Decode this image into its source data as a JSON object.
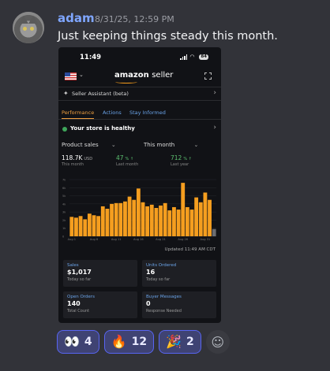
{
  "message": {
    "username": "adam",
    "timestamp": "8/31/25, 12:59 PM",
    "text": "Just keeping things steady this month."
  },
  "screenshot": {
    "status_time": "11:49",
    "battery": "84",
    "app_logo": "amazon",
    "app_logo_suffix": "seller",
    "assistant_label": "Seller Assistant (beta)",
    "tabs": [
      "Performance",
      "Actions",
      "Stay Informed"
    ],
    "health_text": "Your store is healthy",
    "metric_select": "Product sales",
    "period_select": "This month",
    "stats": [
      {
        "value": "118.7K",
        "unit": "USD",
        "sub": "This month"
      },
      {
        "value": "47",
        "pct": "% ↑",
        "sub": "Last month"
      },
      {
        "value": "712",
        "pct": "% ↑",
        "sub": "Last year"
      }
    ],
    "updated": "Updated 11:49 AM CDT",
    "cards": [
      {
        "title": "Sales",
        "value": "$1,017",
        "sub": "Today so far"
      },
      {
        "title": "Units Ordered",
        "value": "16",
        "sub": "Today so far"
      },
      {
        "title": "Open Orders",
        "value": "140",
        "sub": "Total Count"
      },
      {
        "title": "Buyer Messages",
        "value": "0",
        "sub": "Response Needed"
      }
    ]
  },
  "chart_data": {
    "type": "bar",
    "yticks": [
      "7k",
      "6k",
      "5k",
      "4k",
      "3k",
      "2k",
      "1k",
      "0"
    ],
    "xticks": [
      "Aug 1",
      "Aug 6",
      "Aug 11",
      "Aug 16",
      "Aug 21",
      "Aug 26",
      "Aug 31"
    ],
    "ylim": [
      0,
      7000
    ],
    "values": [
      2400,
      2300,
      2500,
      2100,
      2800,
      2600,
      2500,
      3700,
      3400,
      4000,
      4100,
      4100,
      4300,
      4900,
      4500,
      5900,
      4200,
      3700,
      3900,
      3500,
      3800,
      4100,
      3200,
      3600,
      3300,
      6600,
      3600,
      3300,
      4800,
      4200,
      5400,
      4500,
      900
    ],
    "colors": {
      "bar": "#f59e1f",
      "last_bar": "#6b6c70"
    }
  },
  "reactions": [
    {
      "emoji": "👀",
      "count": "4"
    },
    {
      "emoji": "🔥",
      "count": "12"
    },
    {
      "emoji": "🎉",
      "count": "2"
    }
  ],
  "add_reaction_icon": "smile-plus-icon"
}
